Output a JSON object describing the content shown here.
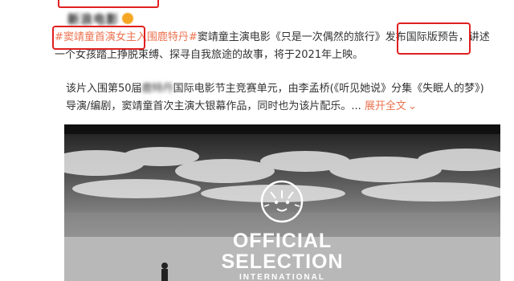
{
  "author": {
    "name": "新浪电影"
  },
  "post": {
    "topic": "#窦靖童首演女主入围鹿特丹#",
    "line1_rest": "窦靖童主演电影《只是一次偶然的旅行》发布国际版预告，讲述",
    "line2": "一个女孩踏上挣脱束缚、探寻自我旅途的故事，将于2021年上映。",
    "para2_line1_a": "该片入围第50届",
    "para2_blur": "鹿特丹",
    "para2_line1_b": "国际电影节主竞赛单元，由李孟桥(《听见她说》分集《失眠人的梦》)",
    "para2_line2": "导演/编剧，窦靖童首次主演大银幕作品，同时也为该片配乐。...",
    "expand_label": "展开全文",
    "expand_icon": "chevron-down-icon"
  },
  "poster": {
    "line1": "OFFICIAL",
    "line2": "SELECTION",
    "line3": "INTERNATIONAL",
    "logo_icon": "tiger-logo-icon",
    "bg_color": "#d9d9d9"
  },
  "colors": {
    "highlight": "#e02020",
    "link": "#eb7350",
    "text": "#333333"
  }
}
